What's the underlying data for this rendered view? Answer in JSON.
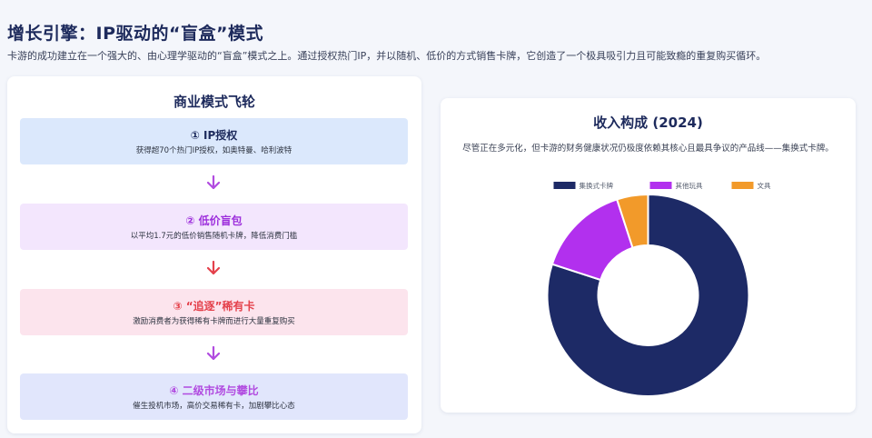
{
  "header": {
    "title": "增长引擎：IP驱动的“盲盒”模式",
    "subtitle": "卡游的成功建立在一个强大的、由心理学驱动的“盲盒”模式之上。通过授权热门IP，并以随机、低价的方式销售卡牌，它创造了一个极具吸引力且可能致瘾的重复购买循环。"
  },
  "flywheel": {
    "title": "商业模式飞轮",
    "steps": [
      {
        "title": "① IP授权",
        "desc": "获得超70个热门IP授权，如奥特曼、哈利波特"
      },
      {
        "title": "② 低价盲包",
        "desc": "以平均1.7元的低价销售随机卡牌，降低消费门槛"
      },
      {
        "title": "③ “追逐”稀有卡",
        "desc": "激励消费者为获得稀有卡牌而进行大量重复购买"
      },
      {
        "title": "④ 二级市场与攀比",
        "desc": "催生投机市场，高价交易稀有卡，加剧攀比心态"
      }
    ],
    "arrow_colors": [
      "#b14be0",
      "#e4414b",
      "#b14be0"
    ]
  },
  "revenue": {
    "title": "收入构成 (2024)",
    "desc": "尽管正在多元化，但卡游的财务健康状况仍极度依赖其核心且最具争议的产品线——集换式卡牌。"
  },
  "chart_data": {
    "type": "doughnut",
    "title": "收入构成 (2024)",
    "legend_position": "top",
    "labels": [
      "集换式卡牌",
      "其他玩具",
      "文具"
    ],
    "values": [
      80,
      15,
      5
    ],
    "colors": [
      "#1d2a66",
      "#b230ee",
      "#f29a2a"
    ]
  }
}
